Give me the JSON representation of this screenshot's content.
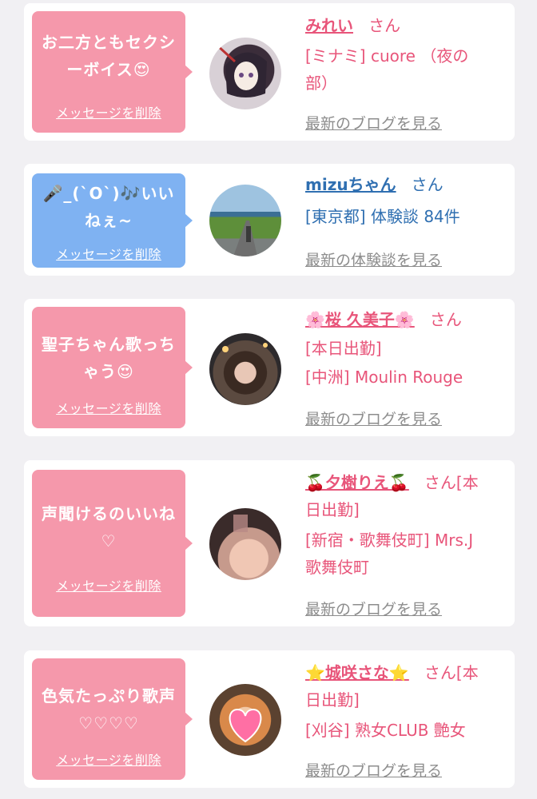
{
  "cards": [
    {
      "message": "お二方ともセクシーボイス😍",
      "delete_label": "メッセージを削除",
      "name": "みれい",
      "honorific": "さん",
      "detail_lines": [
        "[ミナミ] cuore （夜の",
        "部）"
      ],
      "link_label": "最新のブログを見る"
    },
    {
      "message_line1": "🎤_(`O`)🎶いい",
      "message_line2": "ねぇ~",
      "delete_label": "メッセージを削除",
      "name": "mizuちゃん",
      "honorific": "さん",
      "detail_lines": [
        "[東京都] 体験談 84件"
      ],
      "link_label": "最新の体験談を見る"
    },
    {
      "message_line1": "聖子ちゃん歌っち",
      "message_line2": "ゃう😍",
      "delete_label": "メッセージを削除",
      "name": "🌸桜 久美子🌸",
      "honorific": "さん",
      "detail_lines": [
        "[本日出勤]",
        "[中洲] Moulin Rouge"
      ],
      "link_label": "最新のブログを見る"
    },
    {
      "message_line1": "声聞けるのいいね",
      "message_line2": "♡",
      "delete_label": "メッセージを削除",
      "name": "🍒夕樹りえ🍒",
      "honorific": "さん[本",
      "detail_lines": [
        "日出勤]",
        "[新宿・歌舞伎町] Mrs.J",
        "歌舞伎町"
      ],
      "link_label": "最新のブログを見る"
    },
    {
      "message_line1": "色気たっぷり歌声",
      "message_line2": "♡♡♡♡",
      "delete_label": "メッセージを削除",
      "name": "⭐城咲さな⭐",
      "honorific": "さん[本",
      "detail_lines": [
        "日出勤]",
        "[刈谷] 熟女CLUB 艶女"
      ],
      "link_label": "最新のブログを見る"
    }
  ],
  "colors": {
    "pink_bubble": "#f598ab",
    "blue_bubble": "#7fb2f2",
    "pink_text": "#e8557a",
    "blue_text": "#2f6fb1",
    "background": "#f1f0f3"
  },
  "icons": [
    "avatar-photo"
  ]
}
